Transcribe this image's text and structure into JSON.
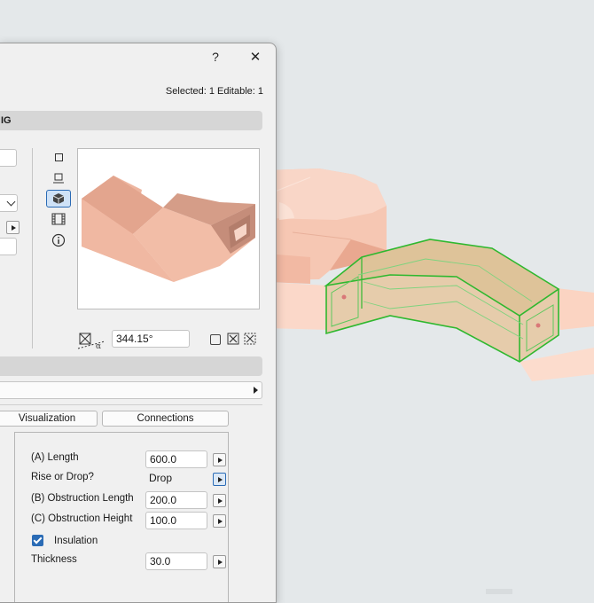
{
  "dialog": {
    "help_label": "?",
    "close_label": "✕",
    "selection_info": "Selected: 1 Editable: 1",
    "section_partial_title": "IG",
    "preview_angle": "344.15°",
    "tabs": [
      {
        "label": "Visualization"
      },
      {
        "label": "Connections"
      }
    ],
    "params": [
      {
        "label": "(A) Length",
        "value": "600.0"
      },
      {
        "label": "Rise or Drop?",
        "value": "Drop"
      },
      {
        "label": "(B) Obstruction Length",
        "value": "200.0"
      },
      {
        "label": "(C) Obstruction Height",
        "value": "100.0"
      },
      {
        "label": "Insulation",
        "checked": true
      },
      {
        "label": "Thickness",
        "value": "30.0"
      }
    ]
  },
  "colors": {
    "panel_bg": "#f0f0f0",
    "section_bar": "#d6d6d6",
    "accent": "#2a6bb5",
    "duct_fill": "#f2b7a0",
    "selection_green": "#2fb82f",
    "viewport_bg": "#e4e8ea"
  }
}
